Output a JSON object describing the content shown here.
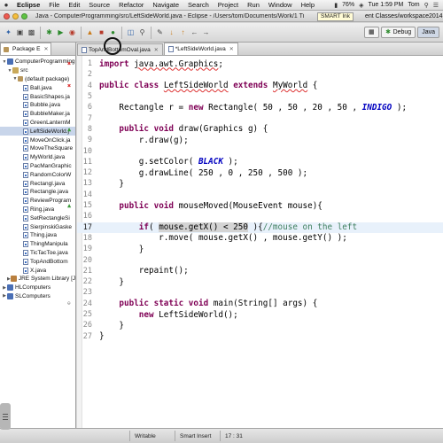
{
  "menubar": {
    "app": "Eclipse",
    "menus": [
      "File",
      "Edit",
      "Source",
      "Refactor",
      "Navigate",
      "Search",
      "Project",
      "Run",
      "Window",
      "Help"
    ],
    "battery": "76%",
    "clock": "Tue 1:59 PM",
    "user": "Tom"
  },
  "window": {
    "title": "Java - ComputerProgramming/src/LeftSideWorld.java - Eclipse - /Users/tom/Documents/Work/1 Ti",
    "title_tail": "ent Classes/workspace2014",
    "tooltip": "SMART Ink"
  },
  "toolbar": {
    "perspectives": [
      "Debug",
      "Java"
    ],
    "active_perspective": "Java"
  },
  "package_explorer": {
    "tab_label": "Package E",
    "tree": [
      {
        "label": "ComputerProgramming",
        "level": 0,
        "kind": "project",
        "expanded": true
      },
      {
        "label": "src",
        "level": 1,
        "kind": "src",
        "expanded": true
      },
      {
        "label": "(default package)",
        "level": 2,
        "kind": "package",
        "expanded": true
      },
      {
        "label": "Ball.java",
        "level": 3,
        "kind": "java"
      },
      {
        "label": "BasicShapes.ja",
        "level": 3,
        "kind": "java"
      },
      {
        "label": "Bubble.java",
        "level": 3,
        "kind": "java"
      },
      {
        "label": "BubbleMaker.ja",
        "level": 3,
        "kind": "java"
      },
      {
        "label": "GreenLanternM",
        "level": 3,
        "kind": "java"
      },
      {
        "label": "LeftSideWorld.j",
        "level": 3,
        "kind": "java",
        "selected": true
      },
      {
        "label": "MoveOnClick.ja",
        "level": 3,
        "kind": "java"
      },
      {
        "label": "MoveTheSquare",
        "level": 3,
        "kind": "java"
      },
      {
        "label": "MyWorld.java",
        "level": 3,
        "kind": "java"
      },
      {
        "label": "PacManGraphic",
        "level": 3,
        "kind": "java"
      },
      {
        "label": "RandomColorW",
        "level": 3,
        "kind": "java"
      },
      {
        "label": "Rectangl.java",
        "level": 3,
        "kind": "java"
      },
      {
        "label": "Rectangle.java",
        "level": 3,
        "kind": "java"
      },
      {
        "label": "ReviewProgram",
        "level": 3,
        "kind": "java"
      },
      {
        "label": "Ring.java",
        "level": 3,
        "kind": "java"
      },
      {
        "label": "SetRectangleSi",
        "level": 3,
        "kind": "java"
      },
      {
        "label": "SierpinskiGaske",
        "level": 3,
        "kind": "java"
      },
      {
        "label": "Thing.java",
        "level": 3,
        "kind": "java"
      },
      {
        "label": "ThingManipula",
        "level": 3,
        "kind": "java"
      },
      {
        "label": "TicTacToe.java",
        "level": 3,
        "kind": "java"
      },
      {
        "label": "TopAndBottom",
        "level": 3,
        "kind": "java"
      },
      {
        "label": "X.java",
        "level": 3,
        "kind": "java"
      },
      {
        "label": "JRE System Library [Ja",
        "level": 1,
        "kind": "lib"
      },
      {
        "label": "HLComputers",
        "level": 0,
        "kind": "project"
      },
      {
        "label": "SLComputers",
        "level": 0,
        "kind": "project"
      }
    ]
  },
  "editor": {
    "tabs": [
      {
        "label": "TopAndBottomOval.java",
        "active": false
      },
      {
        "label": "*LeftSideWorld.java",
        "active": true
      }
    ],
    "lines": [
      {
        "n": "1",
        "t": "import java.awt.Graphics;"
      },
      {
        "n": "2",
        "t": ""
      },
      {
        "n": "4",
        "t": "public class LeftSideWorld extends MyWorld {"
      },
      {
        "n": "5",
        "t": ""
      },
      {
        "n": "6",
        "t": "    Rectangle r = new Rectangle( 50 , 50 , 20 , 50 , INDIGO );"
      },
      {
        "n": "7",
        "t": ""
      },
      {
        "n": "8",
        "t": "    public void draw(Graphics g) {"
      },
      {
        "n": "9",
        "t": "        r.draw(g);"
      },
      {
        "n": "10",
        "t": ""
      },
      {
        "n": "11",
        "t": "        g.setColor( BLACK );"
      },
      {
        "n": "12",
        "t": "        g.drawLine( 250 , 0 , 250 , 500 );"
      },
      {
        "n": "13",
        "t": "    }"
      },
      {
        "n": "14",
        "t": ""
      },
      {
        "n": "15",
        "t": "    public void mouseMoved(MouseEvent mouse){"
      },
      {
        "n": "16",
        "t": ""
      },
      {
        "n": "17",
        "t": "        if( mouse.getX() < 250 ){//mouse on the left"
      },
      {
        "n": "18",
        "t": "            r.move( mouse.getX() , mouse.getY() );"
      },
      {
        "n": "19",
        "t": "        }"
      },
      {
        "n": "20",
        "t": ""
      },
      {
        "n": "21",
        "t": "        repaint();"
      },
      {
        "n": "22",
        "t": "    }"
      },
      {
        "n": "23",
        "t": ""
      },
      {
        "n": "24",
        "t": "    public static void main(String[] args) {"
      },
      {
        "n": "25",
        "t": "        new LeftSideWorld();"
      },
      {
        "n": "26",
        "t": "    }"
      },
      {
        "n": "27",
        "t": "}"
      }
    ],
    "current_line": "17"
  },
  "status": {
    "writable": "Writable",
    "insert_mode": "Smart Insert",
    "position": "17 : 31"
  }
}
